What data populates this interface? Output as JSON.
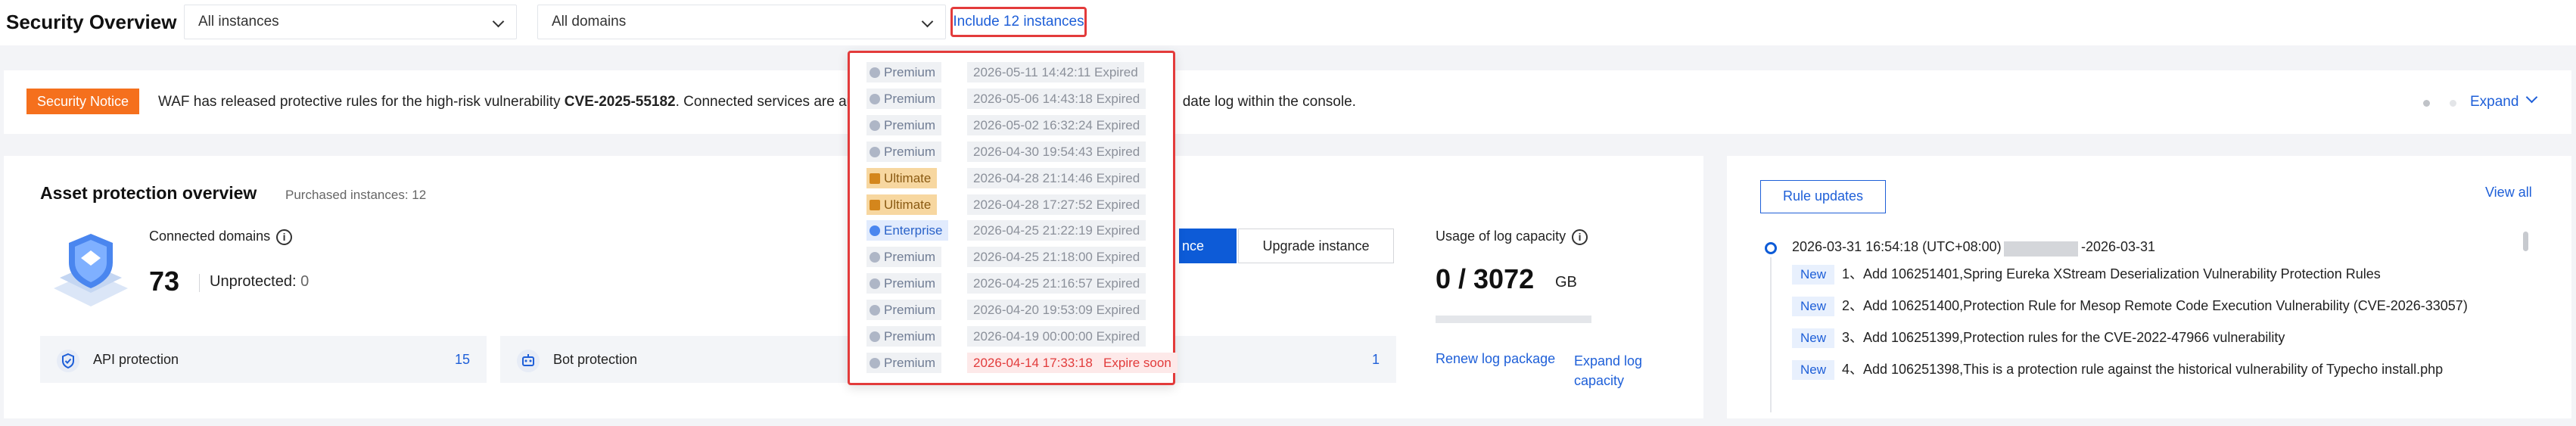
{
  "header": {
    "title": "Security Overview",
    "instance_select": "All instances",
    "domain_select": "All domains",
    "include_link": "Include 12 instances"
  },
  "notice": {
    "tag": "Security Notice",
    "text_before": "WAF has released protective rules for the high-risk vulnerability ",
    "cve": "CVE-2025-55182",
    "text_after": ". Connected services are automat",
    "text_tail": "date log within the console.",
    "expand": "Expand"
  },
  "asset": {
    "title": "Asset protection overview",
    "purchased": "Purchased instances: 12",
    "connected_label": "Connected domains",
    "connected_count": "73",
    "unprotected_label": "Unprotected:",
    "unprotected_count": "0",
    "primary_btn_partial": "nce",
    "upgrade_btn": "Upgrade instance",
    "log_label": "Usage of log capacity",
    "log_value": "0 / 3072",
    "log_unit": "GB",
    "log_usage_fraction": 0,
    "renew_link": "Renew log package",
    "expand_log_link": "Expand log capacity",
    "mini_cards": [
      {
        "label": "API protection",
        "count": "15",
        "icon": "shield-check-icon"
      },
      {
        "label": "Bot protection",
        "count": "",
        "icon": "bot-icon"
      },
      {
        "label": "",
        "count": "1",
        "icon": ""
      }
    ]
  },
  "rules": {
    "button": "Rule updates",
    "view_all": "View all",
    "date": "2026-03-31 16:54:18 (UTC+08:00)",
    "date_range_end": "-2026-03-31",
    "badge": "New",
    "items": [
      "1、Add 106251401,Spring Eureka XStream Deserialization Vulnerability Protection Rules",
      "2、Add 106251400,Protection Rule for Mesop Remote Code Execution Vulnerability (CVE-2026-33057)",
      "3、Add 106251399,Protection rules for the CVE-2022-47966 vulnerability",
      "4、Add 106251398,This is a protection rule against the historical vulnerability of Typecho install.php"
    ]
  },
  "dropdown": {
    "instances": [
      {
        "tier": "Premium",
        "expiry": "2026-05-11 14:42:11 Expired",
        "kind": "premium"
      },
      {
        "tier": "Premium",
        "expiry": "2026-05-06 14:43:18 Expired",
        "kind": "premium"
      },
      {
        "tier": "Premium",
        "expiry": "2026-05-02 16:32:24 Expired",
        "kind": "premium"
      },
      {
        "tier": "Premium",
        "expiry": "2026-04-30 19:54:43 Expired",
        "kind": "premium"
      },
      {
        "tier": "Ultimate",
        "expiry": "2026-04-28 21:14:46 Expired",
        "kind": "ultimate"
      },
      {
        "tier": "Ultimate",
        "expiry": "2026-04-28 17:27:52 Expired",
        "kind": "ultimate"
      },
      {
        "tier": "Enterprise",
        "expiry": "2026-04-25 21:22:19 Expired",
        "kind": "enterprise"
      },
      {
        "tier": "Premium",
        "expiry": "2026-04-25 21:18:00 Expired",
        "kind": "premium"
      },
      {
        "tier": "Premium",
        "expiry": "2026-04-25 21:16:57 Expired",
        "kind": "premium"
      },
      {
        "tier": "Premium",
        "expiry": "2026-04-20 19:53:09 Expired",
        "kind": "premium"
      },
      {
        "tier": "Premium",
        "expiry": "2026-04-19 00:00:00 Expired",
        "kind": "premium"
      },
      {
        "tier": "Premium",
        "expiry": "2026-04-14 17:33:18   Expire soon",
        "kind": "premium",
        "soon": true
      }
    ]
  }
}
